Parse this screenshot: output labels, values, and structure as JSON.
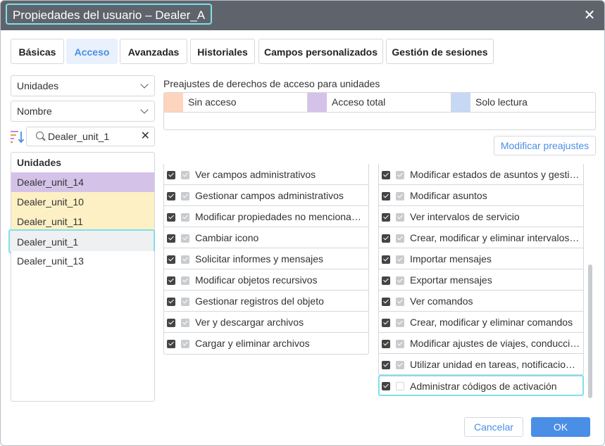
{
  "dialog": {
    "title": "Propiedades del usuario – Dealer_A",
    "close_label": "✕"
  },
  "tabs": [
    {
      "label": "Básicas",
      "active": false
    },
    {
      "label": "Acceso",
      "active": true
    },
    {
      "label": "Avanzadas",
      "active": false
    },
    {
      "label": "Historiales",
      "active": false
    },
    {
      "label": "Campos personalizados",
      "active": false
    },
    {
      "label": "Gestión de sesiones",
      "active": false
    }
  ],
  "filters": {
    "type_select": "Unidades",
    "sort_select": "Nombre",
    "search_value": "Dealer_unit_1",
    "search_clear": "✕"
  },
  "unit_list": {
    "header": "Unidades",
    "items": [
      {
        "name": "Dealer_unit_14",
        "color": "#d5c2e8"
      },
      {
        "name": "Dealer_unit_10",
        "color": "#fdf0c4"
      },
      {
        "name": "Dealer_unit_11",
        "color": "#fdf0c4"
      },
      {
        "name": "Dealer_unit_1",
        "color": "#eef0f2"
      },
      {
        "name": "Dealer_unit_13",
        "color": "#ffffff"
      }
    ]
  },
  "presets": {
    "label": "Preajustes de derechos de acceso para unidades",
    "items": [
      {
        "label": "Sin acceso",
        "color": "#ffd4bd"
      },
      {
        "label": "Acceso total",
        "color": "#d5c2e8"
      },
      {
        "label": "Solo lectura",
        "color": "#c6d8f3"
      }
    ],
    "modify_button": "Modificar preajustes"
  },
  "rights": {
    "left": [
      {
        "label": "Ver campos administrativos",
        "secondary": true
      },
      {
        "label": "Gestionar campos administrativos",
        "secondary": true
      },
      {
        "label": "Modificar propiedades no mencionadas",
        "secondary": true
      },
      {
        "label": "Cambiar icono",
        "secondary": true
      },
      {
        "label": "Solicitar informes y mensajes",
        "secondary": true
      },
      {
        "label": "Modificar objetos recursivos",
        "secondary": true
      },
      {
        "label": "Gestionar registros del objeto",
        "secondary": true
      },
      {
        "label": "Ver y descargar archivos",
        "secondary": true
      },
      {
        "label": "Cargar y eliminar archivos",
        "secondary": true
      }
    ],
    "right": [
      {
        "label": "Modificar estados de asuntos y gestión",
        "secondary": true
      },
      {
        "label": "Modificar asuntos",
        "secondary": true
      },
      {
        "label": "Ver intervalos de servicio",
        "secondary": true
      },
      {
        "label": "Crear, modificar y eliminar intervalos de servicio",
        "secondary": true
      },
      {
        "label": "Importar mensajes",
        "secondary": true
      },
      {
        "label": "Exportar mensajes",
        "secondary": true
      },
      {
        "label": "Ver comandos",
        "secondary": true
      },
      {
        "label": "Crear, modificar y eliminar comandos",
        "secondary": true
      },
      {
        "label": "Modificar ajustes de viajes, conducción",
        "secondary": true
      },
      {
        "label": "Utilizar unidad en tareas, notificaciones",
        "secondary": true
      },
      {
        "label": "Administrar códigos de activación",
        "secondary": false
      }
    ]
  },
  "footer": {
    "cancel": "Cancelar",
    "ok": "OK"
  },
  "colors": {
    "accent": "#4a8ee6",
    "titlebar": "#5f646c",
    "focus": "#7ee0ea"
  }
}
